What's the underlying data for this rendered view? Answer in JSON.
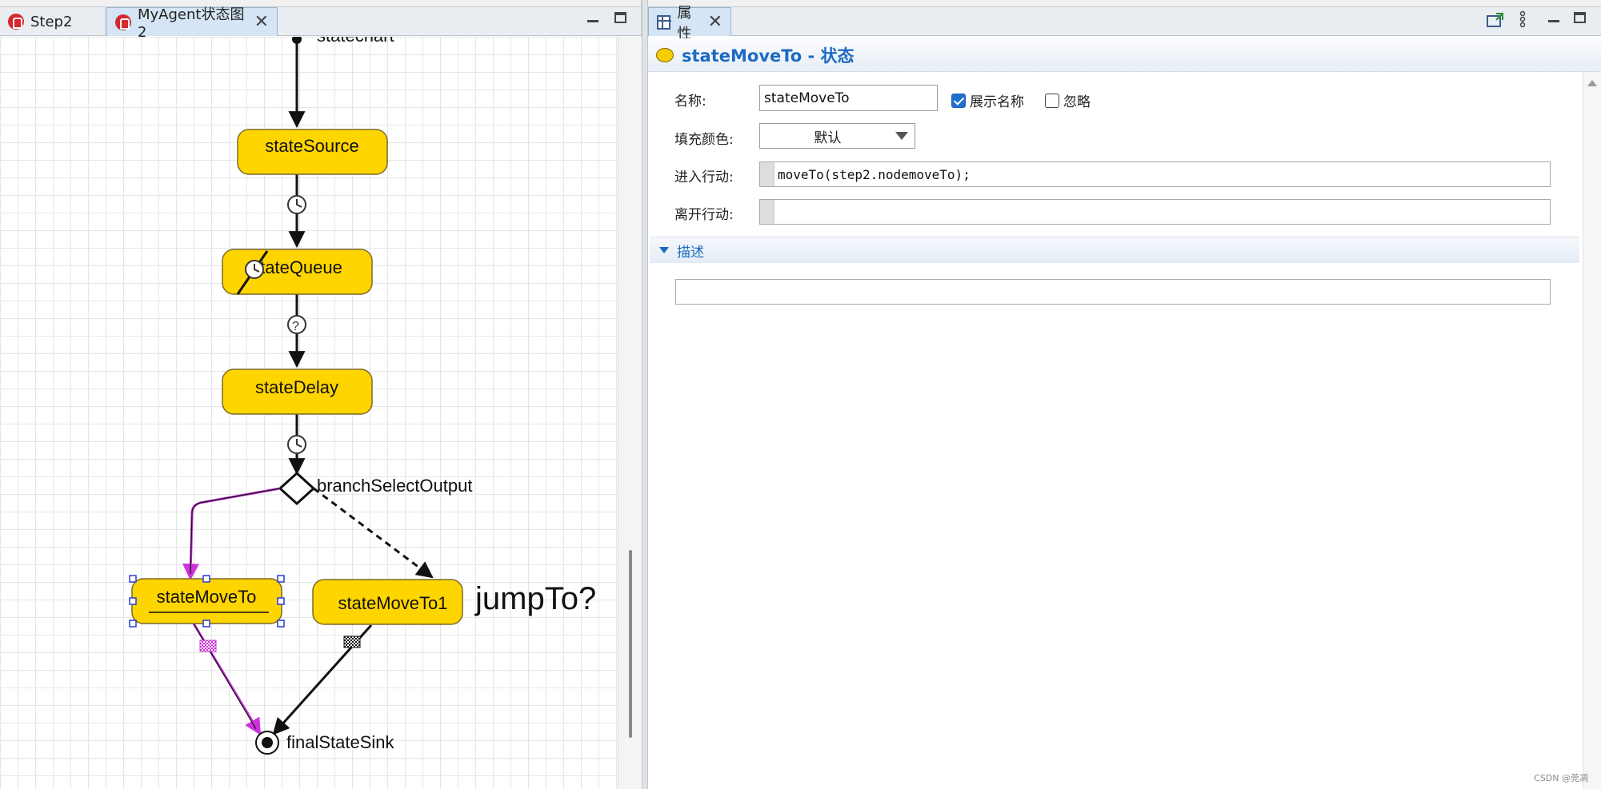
{
  "editor": {
    "tabs": [
      {
        "label": "Step2"
      },
      {
        "label": "MyAgent状态图2"
      }
    ],
    "diagram": {
      "statechart_label": "statechart",
      "states": [
        {
          "name": "stateSource"
        },
        {
          "name": "stateQueue"
        },
        {
          "name": "stateDelay"
        },
        {
          "name": "stateMoveTo"
        },
        {
          "name": "stateMoveTo1"
        }
      ],
      "branch_label": "branchSelectOutput",
      "final_label": "finalStateSink",
      "note": "jumpTo?",
      "colors": {
        "state_fill": "#ffd500",
        "state_border": "#7a6a2a",
        "selection": "#cc33dd",
        "handle": "#2a3bd6"
      }
    }
  },
  "properties": {
    "tab_label": "属性",
    "title": "stateMoveTo - 状态",
    "name_label": "名称:",
    "name_value": "stateMoveTo",
    "show_name_label": "展示名称",
    "show_name_checked": true,
    "ignore_label": "忽略",
    "ignore_checked": false,
    "fill_color_label": "填充颜色:",
    "fill_color_value": "默认",
    "entry_action_label": "进入行动:",
    "entry_action_code": "moveTo(step2.nodemoveTo);",
    "exit_action_label": "离开行动:",
    "exit_action_code": "",
    "description_section": "描述",
    "description_value": ""
  },
  "watermark": "CSDN @莞凋",
  "colors": {
    "accent": "#1c6ac2",
    "state_icon": "#f7cc00"
  }
}
